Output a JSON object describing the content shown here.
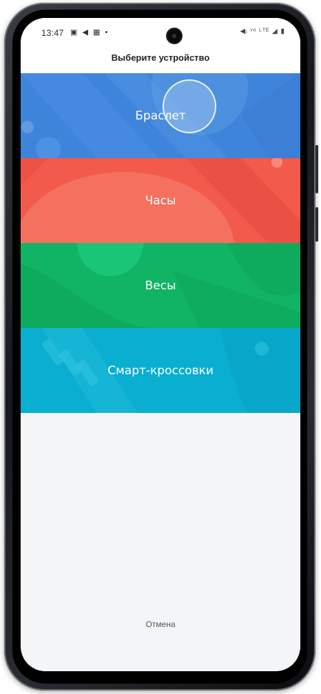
{
  "status_bar": {
    "time": "13:47",
    "left_icons": "▣ ◀ ▦ •",
    "right_icons": "◀ᵢ ᵛᵒ ᴸᵀᴱ ◢ ▮"
  },
  "dialog": {
    "title": "Выберите устройство",
    "options": [
      {
        "label": "Браслет",
        "color": "#3f84db"
      },
      {
        "label": "Часы",
        "color": "#f25a4c"
      },
      {
        "label": "Весы",
        "color": "#10b464"
      },
      {
        "label": "Смарт-кроссовки",
        "color": "#0aaed0"
      }
    ],
    "cancel_label": "Отмена"
  }
}
